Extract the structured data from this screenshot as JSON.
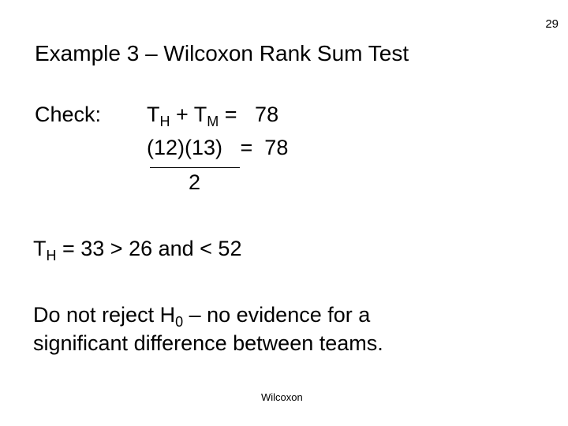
{
  "page_number": "29",
  "title": "Example 3 – Wilcoxon Rank Sum Test",
  "check": {
    "label": "Check:",
    "line1": {
      "t1": "T",
      "s1": "H",
      "plus": " + T",
      "s2": "M",
      "rest": " =   78"
    },
    "line2": {
      "numerator": "(12)(13)",
      "rest": "   =  78"
    },
    "denominator": "2"
  },
  "comparison": {
    "t": "T",
    "sub": "H",
    "rest": " = 33 > 26 and < 52"
  },
  "conclusion": {
    "line1_pre": "Do not reject H",
    "line1_sub": "0",
    "line1_post": " – no evidence for a",
    "line2": "significant difference between teams."
  },
  "footer": "Wilcoxon"
}
